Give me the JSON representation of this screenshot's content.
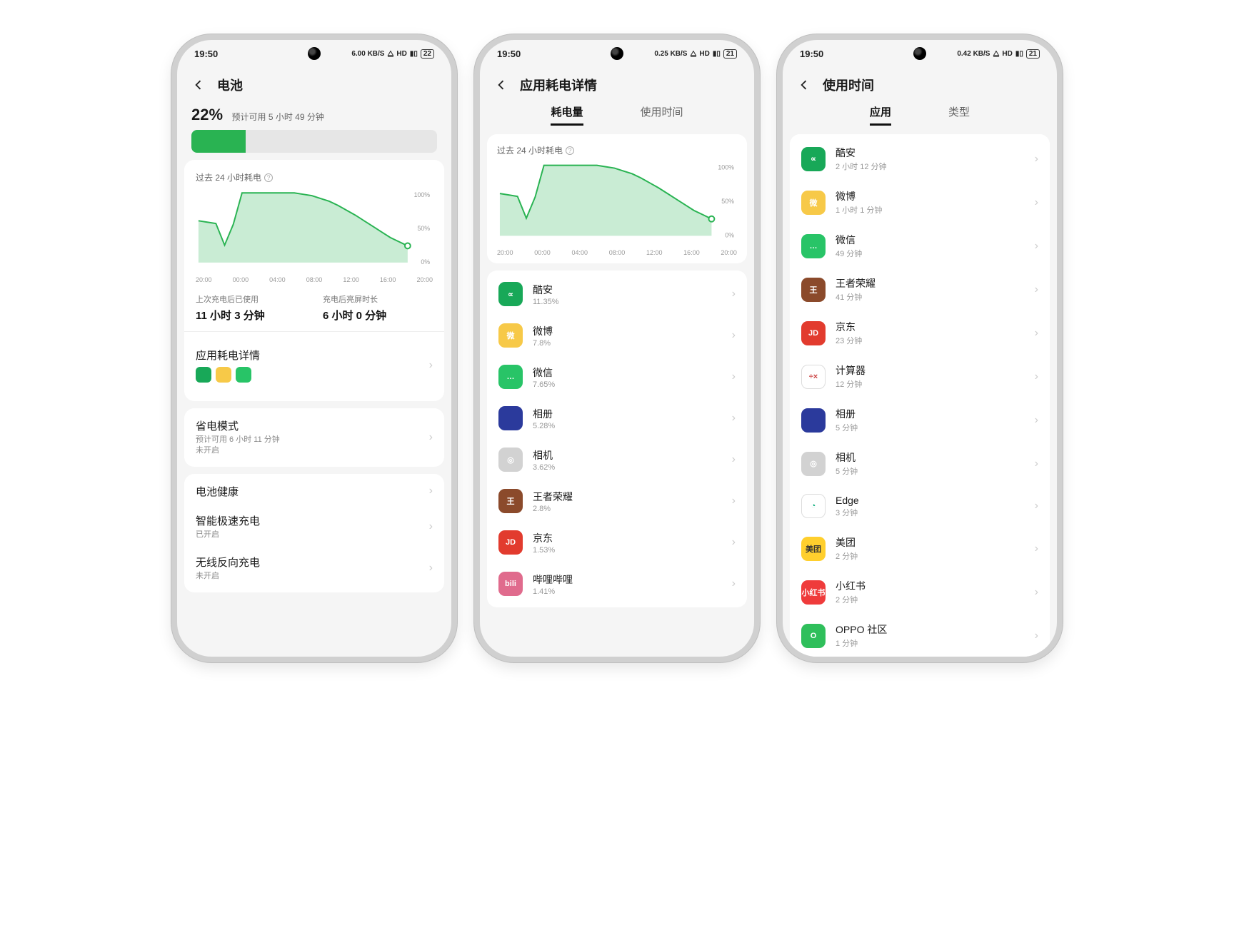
{
  "colors": {
    "green": "#29b352",
    "green_fill": "rgba(41,179,82,0.25)"
  },
  "status": {
    "time": "19:50"
  },
  "status_right": {
    "s1": "6.00 KB/S",
    "b1": "22",
    "s2": "0.25 KB/S",
    "b2": "21",
    "s3": "0.42 KB/S",
    "b3": "21"
  },
  "chart_data": [
    {
      "type": "area",
      "title": "过去 24 小时耗电",
      "ylim": [
        0,
        100
      ],
      "ylabels": [
        "100%",
        "50%",
        "0%"
      ],
      "x_ticks": [
        "20:00",
        "00:00",
        "04:00",
        "08:00",
        "12:00",
        "16:00",
        "20:00"
      ],
      "values": [
        60,
        58,
        56,
        25,
        55,
        100,
        100,
        100,
        100,
        100,
        100,
        100,
        98,
        96,
        92,
        88,
        82,
        75,
        68,
        60,
        52,
        44,
        36,
        30,
        24
      ]
    },
    {
      "type": "area",
      "title": "过去 24 小时耗电",
      "ylim": [
        0,
        100
      ],
      "ylabels": [
        "100%",
        "50%",
        "0%"
      ],
      "x_ticks": [
        "20:00",
        "00:00",
        "04:00",
        "08:00",
        "12:00",
        "16:00",
        "20:00"
      ],
      "values": [
        60,
        58,
        56,
        25,
        55,
        100,
        100,
        100,
        100,
        100,
        100,
        100,
        98,
        96,
        92,
        88,
        82,
        75,
        68,
        60,
        52,
        44,
        36,
        30,
        24
      ]
    }
  ],
  "screen1": {
    "title": "电池",
    "battery_pct": "22%",
    "estimate": "预计可用 5 小时 49 分钟",
    "bar_width_pct": 22,
    "since_charge_label": "上次充电后已使用",
    "since_charge_value": "11 小时 3 分钟",
    "screen_on_label": "充电后亮屏时长",
    "screen_on_value": "6 小时 0 分钟",
    "app_detail_title": "应用耗电详情",
    "power_save": {
      "title": "省电模式",
      "line1": "预计可用 6 小时 11 分钟",
      "line2": "未开启"
    },
    "health": {
      "title": "电池健康"
    },
    "fast_charge": {
      "title": "智能极速充电",
      "sub": "已开启"
    },
    "reverse": {
      "title": "无线反向充电",
      "sub": "未开启"
    }
  },
  "screen2": {
    "title": "应用耗电详情",
    "tab_power": "耗电量",
    "tab_time": "使用时间",
    "apps": [
      {
        "name": "酷安",
        "sub": "11.35%",
        "bg": "#18a858",
        "abbr": "∝"
      },
      {
        "name": "微博",
        "sub": "7.8%",
        "bg": "#f7c948",
        "abbr": "微"
      },
      {
        "name": "微信",
        "sub": "7.65%",
        "bg": "#28c467",
        "abbr": "…"
      },
      {
        "name": "相册",
        "sub": "5.28%",
        "bg": "#2b3a9c",
        "abbr": ""
      },
      {
        "name": "相机",
        "sub": "3.62%",
        "bg": "#d2d2d2",
        "abbr": "◎"
      },
      {
        "name": "王者荣耀",
        "sub": "2.8%",
        "bg": "#8b4a2b",
        "abbr": "王"
      },
      {
        "name": "京东",
        "sub": "1.53%",
        "bg": "#e23b2e",
        "abbr": "JD"
      },
      {
        "name": "哔哩哔哩",
        "sub": "1.41%",
        "bg": "#e06b8d",
        "abbr": "bili"
      }
    ]
  },
  "screen3": {
    "title": "使用时间",
    "tab_apps": "应用",
    "tab_type": "类型",
    "apps": [
      {
        "name": "酷安",
        "sub": "2 小时 12 分钟",
        "bg": "#18a858",
        "abbr": "∝"
      },
      {
        "name": "微博",
        "sub": "1 小时 1 分钟",
        "bg": "#f7c948",
        "abbr": "微"
      },
      {
        "name": "微信",
        "sub": "49 分钟",
        "bg": "#28c467",
        "abbr": "…"
      },
      {
        "name": "王者荣耀",
        "sub": "41 分钟",
        "bg": "#8b4a2b",
        "abbr": "王"
      },
      {
        "name": "京东",
        "sub": "23 分钟",
        "bg": "#e23b2e",
        "abbr": "JD"
      },
      {
        "name": "计算器",
        "sub": "12 分钟",
        "bg": "#ffffff",
        "abbr": "÷×",
        "fg": "#c44"
      },
      {
        "name": "相册",
        "sub": "5 分钟",
        "bg": "#2b3a9c",
        "abbr": ""
      },
      {
        "name": "相机",
        "sub": "5 分钟",
        "bg": "#d2d2d2",
        "abbr": "◎"
      },
      {
        "name": "Edge",
        "sub": "3 分钟",
        "bg": "#ffffff",
        "abbr": "◔",
        "fg": "#0a7"
      },
      {
        "name": "美团",
        "sub": "2 分钟",
        "bg": "#ffcf2d",
        "abbr": "美团",
        "fg": "#333"
      },
      {
        "name": "小红书",
        "sub": "2 分钟",
        "bg": "#ef3b3b",
        "abbr": "小红书"
      },
      {
        "name": "OPPO 社区",
        "sub": "1 分钟",
        "bg": "#2fbf5b",
        "abbr": "O"
      }
    ]
  }
}
